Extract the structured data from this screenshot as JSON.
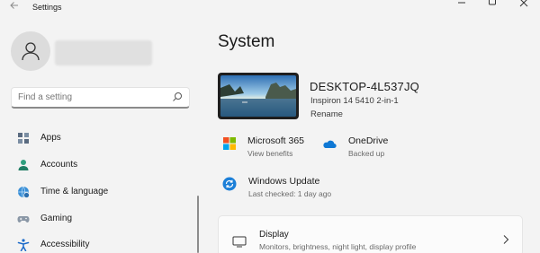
{
  "window": {
    "title": "Settings",
    "back_icon": "arrow-left-icon",
    "controls": [
      "minimize-icon",
      "maximize-icon",
      "close-icon"
    ]
  },
  "sidebar": {
    "search": {
      "placeholder": "Find a setting"
    },
    "items": [
      {
        "label": "Apps",
        "icon": "apps-icon"
      },
      {
        "label": "Accounts",
        "icon": "accounts-icon"
      },
      {
        "label": "Time & language",
        "icon": "globe-clock-icon"
      },
      {
        "label": "Gaming",
        "icon": "gamepad-icon"
      },
      {
        "label": "Accessibility",
        "icon": "accessibility-icon"
      }
    ]
  },
  "main": {
    "title": "System",
    "device": {
      "name": "DESKTOP-4L537JQ",
      "model": "Inspiron 14 5410 2-in-1",
      "rename_label": "Rename"
    },
    "quick_tiles": [
      {
        "title": "Microsoft 365",
        "subtitle": "View benefits",
        "icon": "microsoft-logo-icon"
      },
      {
        "title": "OneDrive",
        "subtitle": "Backed up",
        "icon": "onedrive-cloud-icon"
      },
      {
        "title": "Windows Update",
        "subtitle": "Last checked: 1 day ago",
        "icon": "windows-update-icon"
      }
    ],
    "cards": [
      {
        "title": "Display",
        "subtitle": "Monitors, brightness, night light, display profile",
        "icon": "monitor-icon"
      }
    ]
  },
  "colors": {
    "background": "#f3f3f3",
    "accent": "#0067c0",
    "card_background": "#fbfbfb"
  }
}
